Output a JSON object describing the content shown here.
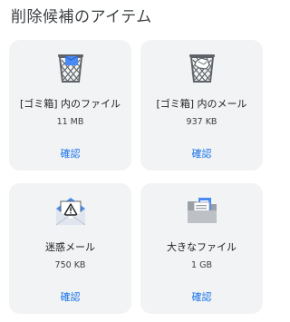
{
  "page": {
    "title": "削除候補のアイテム"
  },
  "cards": [
    {
      "icon": "trash-bin-files-icon",
      "label": "[ゴミ箱] 内のファイル",
      "size": "11 MB",
      "action": "確認"
    },
    {
      "icon": "trash-bin-mail-icon",
      "label": "[ゴミ箱] 内のメール",
      "size": "937 KB",
      "action": "確認"
    },
    {
      "icon": "spam-mail-warning-icon",
      "label": "迷惑メール",
      "size": "750 KB",
      "action": "確認"
    },
    {
      "icon": "large-files-folder-icon",
      "label": "大きなファイル",
      "size": "1 GB",
      "action": "確認"
    }
  ],
  "colors": {
    "accent": "#1a73e8",
    "card_background": "#f1f3f4",
    "icon_blue": "#4a8af4",
    "icon_gray": "#5f6368"
  }
}
